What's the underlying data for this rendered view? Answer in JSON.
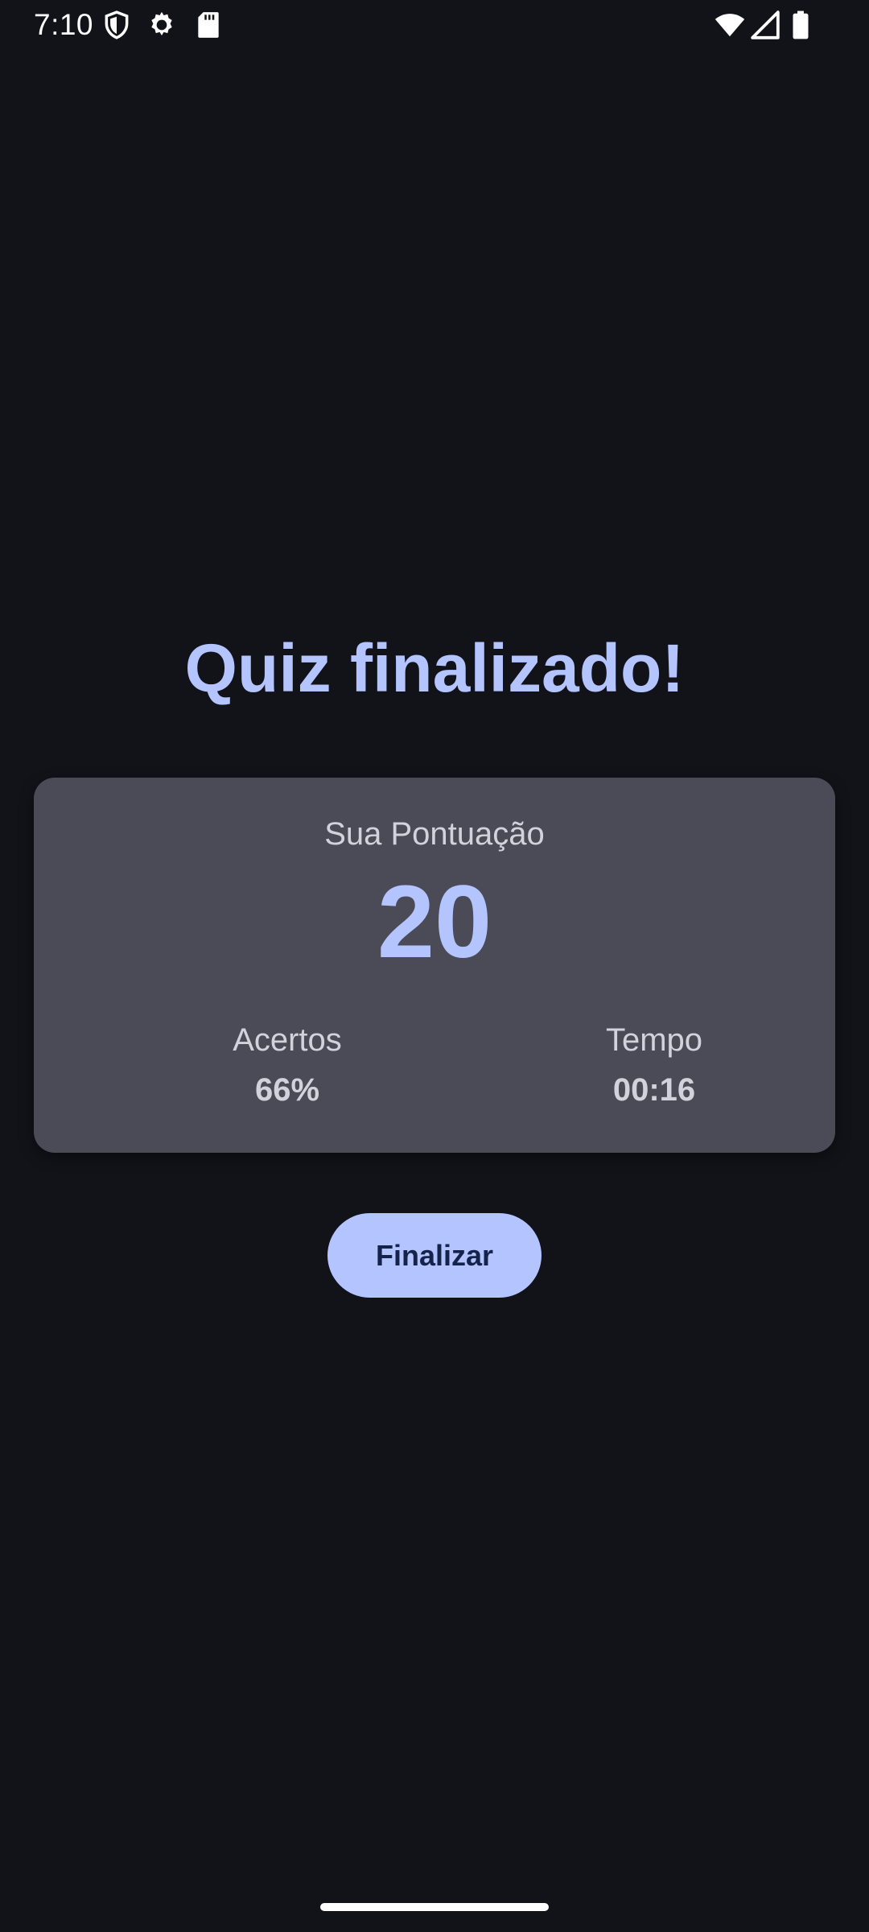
{
  "status_bar": {
    "time": "7:10",
    "left_icons": [
      "shield-icon",
      "gear-icon",
      "sd-card-icon"
    ],
    "right_icons": [
      "wifi-icon",
      "cell-signal-icon",
      "battery-icon"
    ]
  },
  "quiz_result": {
    "title": "Quiz finalizado!",
    "score_label": "Sua Pontuação",
    "score_value": "20",
    "stats": {
      "accuracy_label": "Acertos",
      "accuracy_value": "66%",
      "time_label": "Tempo",
      "time_value": "00:16"
    },
    "finish_button_label": "Finalizar"
  },
  "colors": {
    "background": "#121319",
    "accent": "#b4c4ff",
    "card": "#4a4b56",
    "button_text": "#15224a"
  }
}
